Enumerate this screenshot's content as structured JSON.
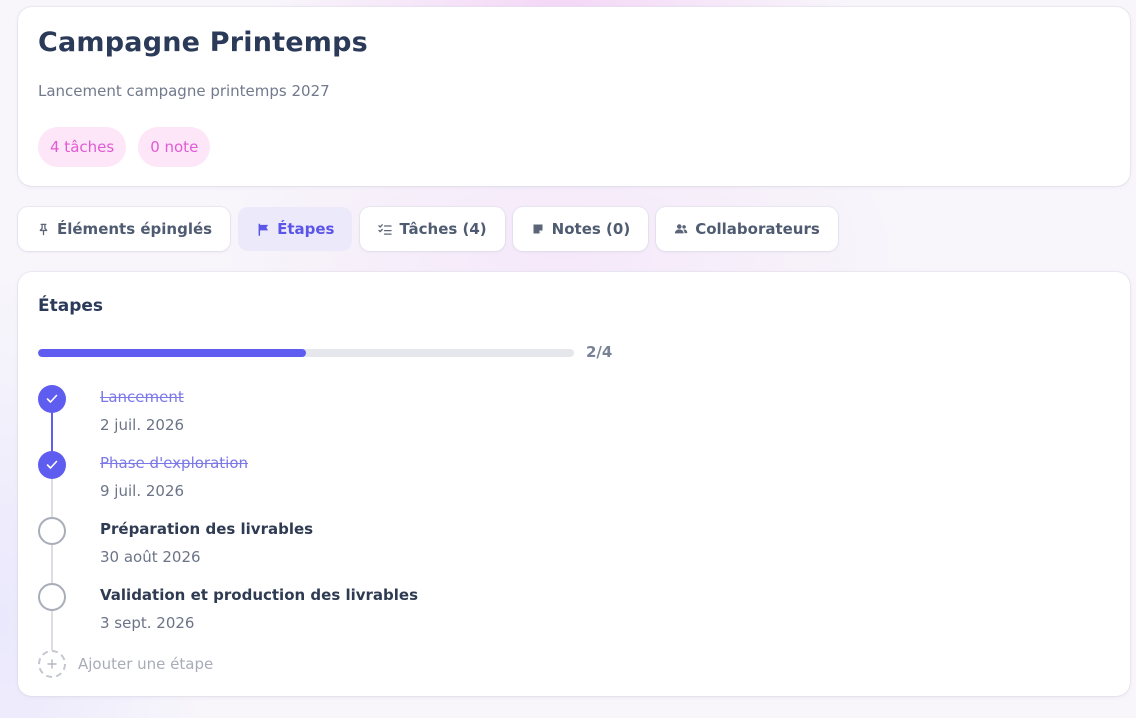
{
  "project": {
    "title": "Campagne Printemps",
    "subtitle": "Lancement campagne printemps 2027",
    "badges": [
      {
        "label": "4 tâches"
      },
      {
        "label": "0 note"
      }
    ]
  },
  "tabs": [
    {
      "label": "Éléments épinglés",
      "icon": "pin-icon",
      "active": false
    },
    {
      "label": "Étapes",
      "icon": "flag-icon",
      "active": true
    },
    {
      "label": "Tâches (4)",
      "icon": "checklist-icon",
      "active": false
    },
    {
      "label": "Notes (0)",
      "icon": "note-icon",
      "active": false
    },
    {
      "label": "Collaborateurs",
      "icon": "users-icon",
      "active": false
    }
  ],
  "milestones": {
    "title": "Étapes",
    "progress_label": "2/4",
    "progress_fraction": 0.5,
    "steps": [
      {
        "title": "Lancement",
        "date": "2 juil. 2026",
        "done": true
      },
      {
        "title": "Phase d'exploration",
        "date": "9 juil. 2026",
        "done": true
      },
      {
        "title": "Préparation des livrables",
        "date": "30 août 2026",
        "done": false
      },
      {
        "title": "Validation et production des livrables",
        "date": "3 sept. 2026",
        "done": false
      }
    ],
    "add_label": "Ajouter une étape"
  },
  "colors": {
    "accent": "#5f5cf0",
    "badge_bg": "#fde6f7",
    "badge_text": "#e05bd4"
  }
}
